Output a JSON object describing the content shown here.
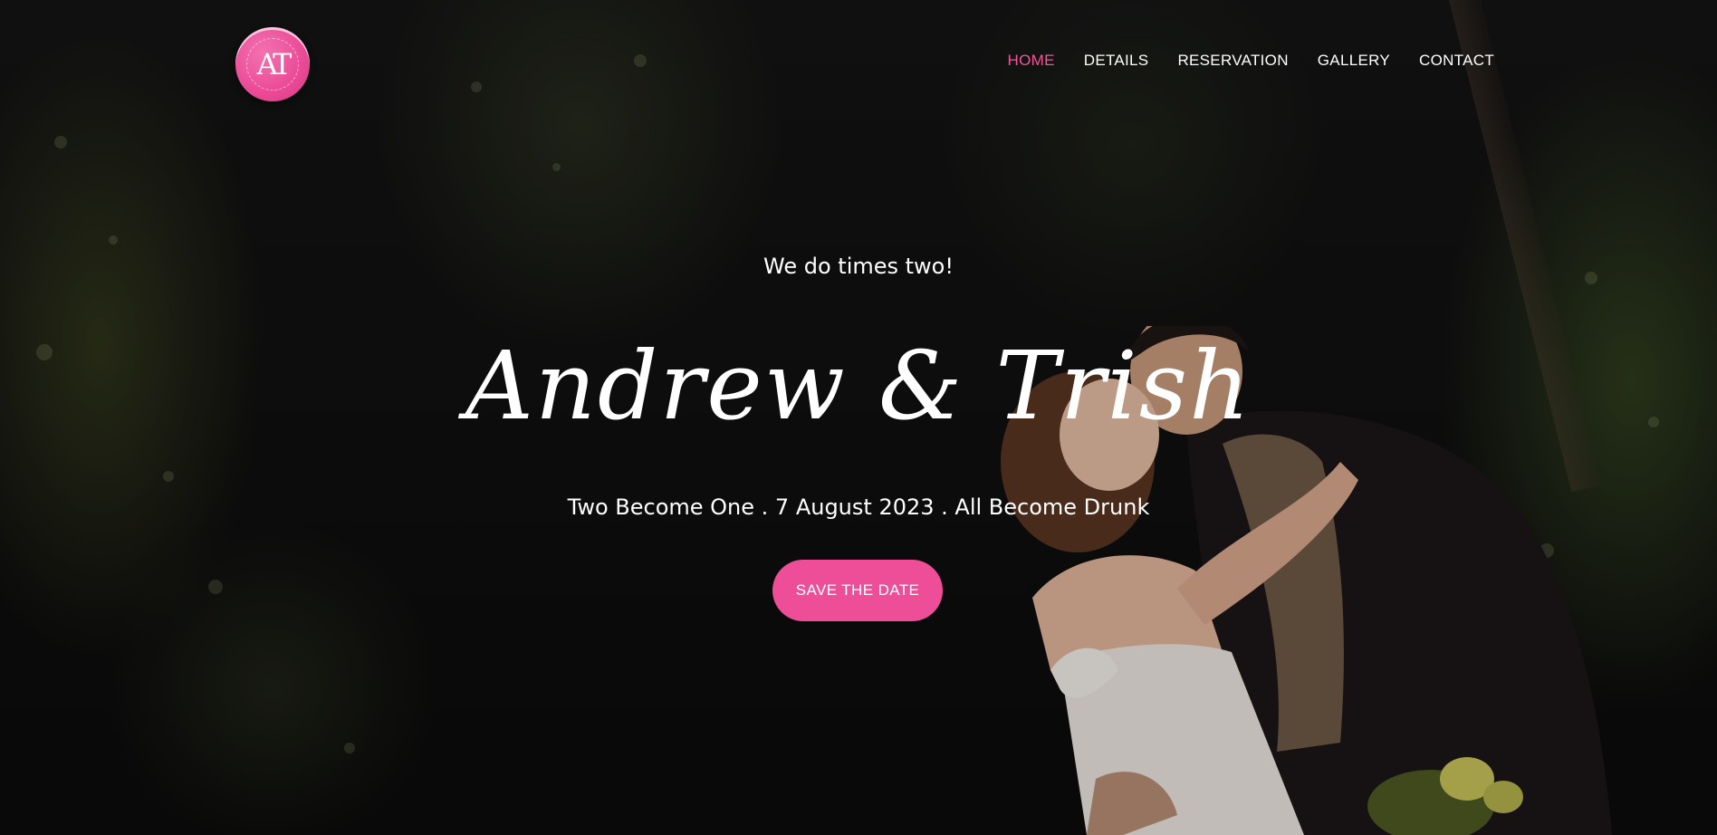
{
  "logo": {
    "text": "AT",
    "alt": "Andrew & Trish logo"
  },
  "nav": {
    "items": [
      {
        "label": "HOME",
        "active": true
      },
      {
        "label": "DETAILS",
        "active": false
      },
      {
        "label": "RESERVATION",
        "active": false
      },
      {
        "label": "GALLERY",
        "active": false
      },
      {
        "label": "CONTACT",
        "active": false
      }
    ]
  },
  "hero": {
    "tagline": "We do times two!",
    "title": "Andrew & Trish",
    "subtitle": "Two Become One . 7 August 2023 . All Become Drunk",
    "cta_label": "SAVE THE DATE"
  },
  "colors": {
    "accent": "#ee4d97",
    "nav_active": "#f0569b",
    "text": "#ffffff",
    "background": "#0d0d0d"
  }
}
